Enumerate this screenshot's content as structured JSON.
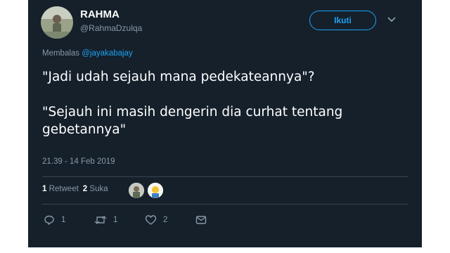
{
  "user": {
    "display_name": "RAHMA",
    "handle": "@RahmaDzulqa"
  },
  "follow_button": {
    "label": "Ikuti"
  },
  "reply_context": {
    "prefix": "Membalas",
    "mention": "@jayakabajay"
  },
  "tweet": {
    "paragraphs": [
      "\"Jadi udah sejauh mana pedekateannya\"?",
      "\"Sejauh ini masih dengerin dia curhat tentang gebetannya\""
    ],
    "timestamp": "21.39 - 14 Feb 2019"
  },
  "stats": {
    "retweet_count": "1",
    "retweet_label": "Retweet",
    "like_count": "2",
    "like_label": "Suka"
  },
  "actions": {
    "reply_count": "1",
    "retweet_count": "1",
    "like_count": "2"
  },
  "icons": [
    "chevron-down-icon",
    "reply-icon",
    "retweet-icon",
    "heart-icon",
    "message-icon"
  ],
  "colors": {
    "background": "#15202b",
    "accent": "#1da1f2",
    "muted": "#8899a6"
  }
}
